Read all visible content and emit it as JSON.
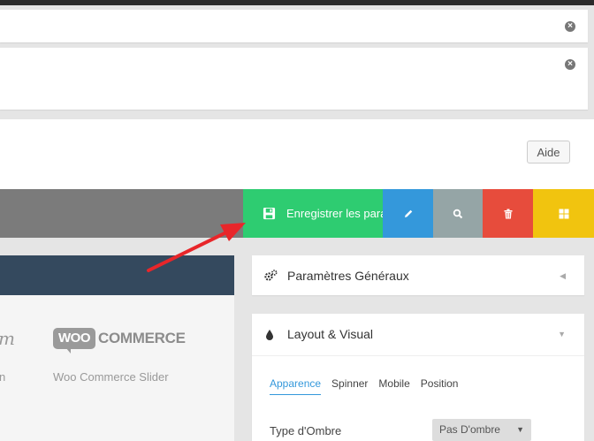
{
  "header": {
    "help_label": "Aide"
  },
  "toolbar": {
    "save_label": "Enregistrer les paramètres",
    "colors": {
      "save": "#2ecc71",
      "edit": "#3498db",
      "search": "#95a5a6",
      "delete": "#e74c3c",
      "grid": "#f1c40f"
    }
  },
  "sources": {
    "partial_logo": "m",
    "partial_caption": "n",
    "woo_logo_woo": "WOO",
    "woo_logo_commerce": "COMMERCE",
    "woo_caption": "Woo Commerce Slider"
  },
  "sidebar": {
    "general_title": "Paramètres Généraux",
    "layout_title": "Layout & Visual",
    "tabs": [
      "Apparence",
      "Spinner",
      "Mobile",
      "Position"
    ],
    "shadow_label": "Type d'Ombre",
    "shadow_value": "Pas D'ombre"
  },
  "icons": [
    "close-icon",
    "save-icon",
    "pencil-icon",
    "search-icon",
    "trash-icon",
    "grid-icon",
    "gears-icon",
    "drop-icon",
    "caret-left-icon",
    "caret-down-icon"
  ]
}
